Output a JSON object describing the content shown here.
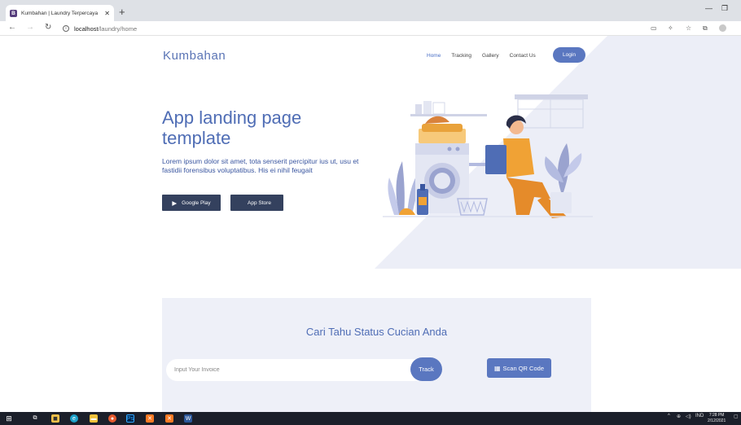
{
  "browser": {
    "tab_title": "Kumbahan | Laundry Terpercaya",
    "favicon": "B",
    "url_host": "localhost",
    "url_path": "/laundry/home"
  },
  "page": {
    "brand": "Kumbahan",
    "nav": [
      {
        "label": "Home",
        "active": true
      },
      {
        "label": "Tracking"
      },
      {
        "label": "Gallery"
      },
      {
        "label": "Contact Us"
      }
    ],
    "login_label": "Login",
    "hero_title": "App landing page template",
    "hero_desc": "Lorem ipsum dolor sit amet, tota senserit percipitur ius ut, usu et fastidii forensibus voluptatibus. His ei nihil feugait",
    "google_play_label": "Google Play",
    "app_store_label": "App Store",
    "tracking": {
      "title": "Cari Tahu Status Cucian Anda",
      "invoice_placeholder": "Input Your Invoice",
      "invoice_value": "",
      "track_label": "Track",
      "qr_label": "Scan QR Code"
    }
  },
  "taskbar": {
    "lang": "IND",
    "time": "7:28 PM",
    "date": "2/12/2021"
  },
  "colors": {
    "primary": "#5a77c0",
    "heading": "#4f6db5",
    "hero_bg": "#eceef7",
    "dark_button": "#34415e"
  }
}
